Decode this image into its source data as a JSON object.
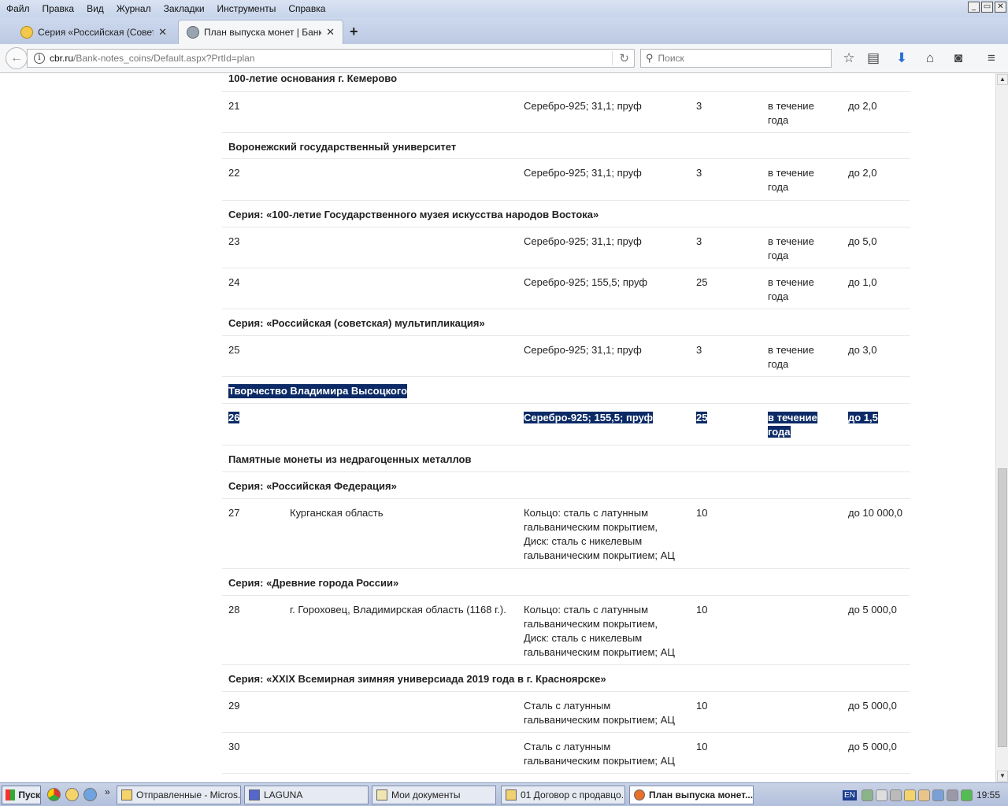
{
  "menu": [
    "Файл",
    "Правка",
    "Вид",
    "Журнал",
    "Закладки",
    "Инструменты",
    "Справка"
  ],
  "window_controls": [
    "_",
    "▭",
    "✕"
  ],
  "tabs": [
    {
      "title": "Серия «Российская (Советс...",
      "close": "✕"
    },
    {
      "title": "План выпуска монет | Банк ...",
      "close": "✕"
    }
  ],
  "new_tab": "+",
  "nav": {
    "url_domain": "cbr.ru",
    "url_path": "/Bank-notes_coins/Default.aspx?PrtId=plan",
    "search_placeholder": "Поиск",
    "back": "←",
    "reload": "↻"
  },
  "toolbar_icons": [
    "star-icon",
    "reading-list-icon",
    "download-icon",
    "home-icon",
    "pocket-icon",
    "hamburger-menu-icon"
  ],
  "rows": [
    {
      "type": "head",
      "text": "100-летие основания г. Кемерово"
    },
    {
      "type": "item",
      "num": "21",
      "name": "",
      "material": "Серебро-925; 31,1; пруф",
      "count": "3",
      "date": "в течение года",
      "amount": "до 2,0"
    },
    {
      "type": "head",
      "text": "Воронежский государственный университет"
    },
    {
      "type": "item",
      "num": "22",
      "name": "",
      "material": "Серебро-925; 31,1; пруф",
      "count": "3",
      "date": "в течение года",
      "amount": "до 2,0"
    },
    {
      "type": "head",
      "text": "Серия: «100-летие Государственного музея искусства народов Востока»"
    },
    {
      "type": "item",
      "num": "23",
      "name": "",
      "material": "Серебро-925; 31,1; пруф",
      "count": "3",
      "date": "в течение года",
      "amount": "до 5,0"
    },
    {
      "type": "item",
      "num": "24",
      "name": "",
      "material": "Серебро-925; 155,5; пруф",
      "count": "25",
      "date": "в течение года",
      "amount": "до 1,0"
    },
    {
      "type": "head",
      "text": "Серия: «Российская (советская) мультипликация»"
    },
    {
      "type": "item",
      "num": "25",
      "name": "",
      "material": "Серебро-925; 31,1; пруф",
      "count": "3",
      "date": "в течение года",
      "amount": "до 3,0"
    },
    {
      "type": "head",
      "text": "Творчество Владимира Высоцкого",
      "selected": true
    },
    {
      "type": "item",
      "num": "26",
      "name": "",
      "material": "Серебро-925; 155,5; пруф",
      "count": "25",
      "date": "в течение года",
      "amount": "до 1,5",
      "selected": true
    },
    {
      "type": "head",
      "text": "Памятные монеты из недрагоценных металлов"
    },
    {
      "type": "head",
      "text": "Серия: «Российская Федерация»"
    },
    {
      "type": "item",
      "num": "27",
      "name": "Курганская область",
      "material": "Кольцо: сталь с латунным гальваническим покрытием, Диск: сталь с никелевым гальваническим покрытием; АЦ",
      "count": "10",
      "date": "",
      "amount": "до 10 000,0"
    },
    {
      "type": "head",
      "text": "Серия: «Древние города России»"
    },
    {
      "type": "item",
      "num": "28",
      "name": "г. Гороховец, Владимирская область (1168 г.).",
      "material": "Кольцо: сталь с латунным гальваническим покрытием, Диск: сталь с никелевым гальваническим покрытием; АЦ",
      "count": "10",
      "date": "",
      "amount": "до 5 000,0"
    },
    {
      "type": "head",
      "text": "Серия: «XXIX Всемирная зимняя универсиада 2019 года в г. Красноярске»"
    },
    {
      "type": "item",
      "num": "29",
      "name": "",
      "material": "Сталь с латунным гальваническим покрытием; АЦ",
      "count": "10",
      "date": "",
      "amount": "до 5 000,0"
    },
    {
      "type": "item",
      "num": "30",
      "name": "",
      "material": "Сталь с латунным гальваническим покрытием; АЦ",
      "count": "10",
      "date": "",
      "amount": "до 5 000,0"
    }
  ],
  "taskbar": {
    "start": "Пуск",
    "buttons": [
      {
        "label": "Отправленные - Micros..."
      },
      {
        "label": "LAGUNA"
      },
      {
        "label": "Мои документы"
      },
      {
        "label": "01 Договор с продавцо..."
      },
      {
        "label": "План выпуска монет..."
      }
    ],
    "lang": "EN",
    "time": "19:55"
  },
  "colors": {
    "selection": "#0b2a66",
    "menubar": "#c7d4ea",
    "taskbar": "#b3c0dc"
  }
}
